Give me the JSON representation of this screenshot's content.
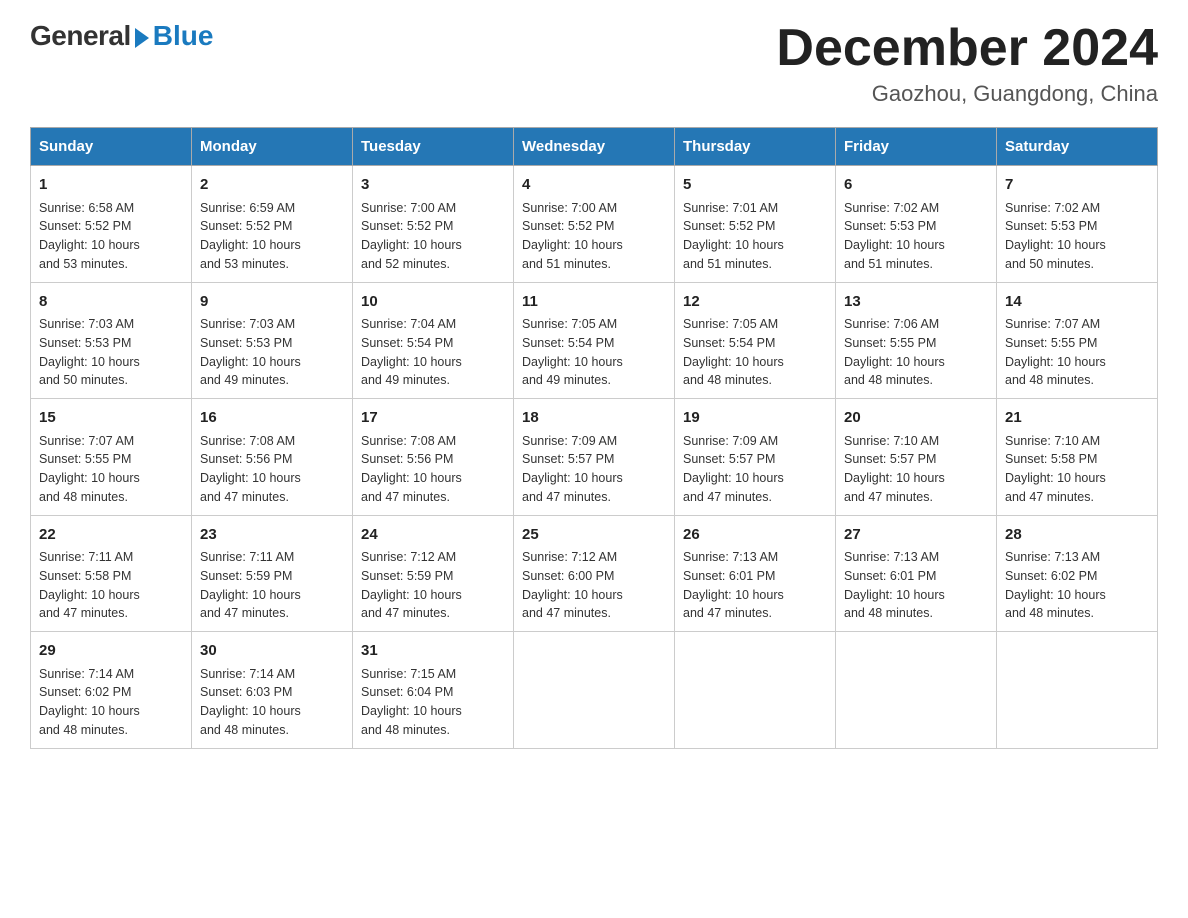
{
  "logo": {
    "general": "General",
    "blue": "Blue"
  },
  "title": {
    "month": "December 2024",
    "location": "Gaozhou, Guangdong, China"
  },
  "days_of_week": [
    "Sunday",
    "Monday",
    "Tuesday",
    "Wednesday",
    "Thursday",
    "Friday",
    "Saturday"
  ],
  "weeks": [
    [
      {
        "day": "1",
        "sunrise": "6:58 AM",
        "sunset": "5:52 PM",
        "daylight": "10 hours and 53 minutes."
      },
      {
        "day": "2",
        "sunrise": "6:59 AM",
        "sunset": "5:52 PM",
        "daylight": "10 hours and 53 minutes."
      },
      {
        "day": "3",
        "sunrise": "7:00 AM",
        "sunset": "5:52 PM",
        "daylight": "10 hours and 52 minutes."
      },
      {
        "day": "4",
        "sunrise": "7:00 AM",
        "sunset": "5:52 PM",
        "daylight": "10 hours and 51 minutes."
      },
      {
        "day": "5",
        "sunrise": "7:01 AM",
        "sunset": "5:52 PM",
        "daylight": "10 hours and 51 minutes."
      },
      {
        "day": "6",
        "sunrise": "7:02 AM",
        "sunset": "5:53 PM",
        "daylight": "10 hours and 51 minutes."
      },
      {
        "day": "7",
        "sunrise": "7:02 AM",
        "sunset": "5:53 PM",
        "daylight": "10 hours and 50 minutes."
      }
    ],
    [
      {
        "day": "8",
        "sunrise": "7:03 AM",
        "sunset": "5:53 PM",
        "daylight": "10 hours and 50 minutes."
      },
      {
        "day": "9",
        "sunrise": "7:03 AM",
        "sunset": "5:53 PM",
        "daylight": "10 hours and 49 minutes."
      },
      {
        "day": "10",
        "sunrise": "7:04 AM",
        "sunset": "5:54 PM",
        "daylight": "10 hours and 49 minutes."
      },
      {
        "day": "11",
        "sunrise": "7:05 AM",
        "sunset": "5:54 PM",
        "daylight": "10 hours and 49 minutes."
      },
      {
        "day": "12",
        "sunrise": "7:05 AM",
        "sunset": "5:54 PM",
        "daylight": "10 hours and 48 minutes."
      },
      {
        "day": "13",
        "sunrise": "7:06 AM",
        "sunset": "5:55 PM",
        "daylight": "10 hours and 48 minutes."
      },
      {
        "day": "14",
        "sunrise": "7:07 AM",
        "sunset": "5:55 PM",
        "daylight": "10 hours and 48 minutes."
      }
    ],
    [
      {
        "day": "15",
        "sunrise": "7:07 AM",
        "sunset": "5:55 PM",
        "daylight": "10 hours and 48 minutes."
      },
      {
        "day": "16",
        "sunrise": "7:08 AM",
        "sunset": "5:56 PM",
        "daylight": "10 hours and 47 minutes."
      },
      {
        "day": "17",
        "sunrise": "7:08 AM",
        "sunset": "5:56 PM",
        "daylight": "10 hours and 47 minutes."
      },
      {
        "day": "18",
        "sunrise": "7:09 AM",
        "sunset": "5:57 PM",
        "daylight": "10 hours and 47 minutes."
      },
      {
        "day": "19",
        "sunrise": "7:09 AM",
        "sunset": "5:57 PM",
        "daylight": "10 hours and 47 minutes."
      },
      {
        "day": "20",
        "sunrise": "7:10 AM",
        "sunset": "5:57 PM",
        "daylight": "10 hours and 47 minutes."
      },
      {
        "day": "21",
        "sunrise": "7:10 AM",
        "sunset": "5:58 PM",
        "daylight": "10 hours and 47 minutes."
      }
    ],
    [
      {
        "day": "22",
        "sunrise": "7:11 AM",
        "sunset": "5:58 PM",
        "daylight": "10 hours and 47 minutes."
      },
      {
        "day": "23",
        "sunrise": "7:11 AM",
        "sunset": "5:59 PM",
        "daylight": "10 hours and 47 minutes."
      },
      {
        "day": "24",
        "sunrise": "7:12 AM",
        "sunset": "5:59 PM",
        "daylight": "10 hours and 47 minutes."
      },
      {
        "day": "25",
        "sunrise": "7:12 AM",
        "sunset": "6:00 PM",
        "daylight": "10 hours and 47 minutes."
      },
      {
        "day": "26",
        "sunrise": "7:13 AM",
        "sunset": "6:01 PM",
        "daylight": "10 hours and 47 minutes."
      },
      {
        "day": "27",
        "sunrise": "7:13 AM",
        "sunset": "6:01 PM",
        "daylight": "10 hours and 48 minutes."
      },
      {
        "day": "28",
        "sunrise": "7:13 AM",
        "sunset": "6:02 PM",
        "daylight": "10 hours and 48 minutes."
      }
    ],
    [
      {
        "day": "29",
        "sunrise": "7:14 AM",
        "sunset": "6:02 PM",
        "daylight": "10 hours and 48 minutes."
      },
      {
        "day": "30",
        "sunrise": "7:14 AM",
        "sunset": "6:03 PM",
        "daylight": "10 hours and 48 minutes."
      },
      {
        "day": "31",
        "sunrise": "7:15 AM",
        "sunset": "6:04 PM",
        "daylight": "10 hours and 48 minutes."
      },
      null,
      null,
      null,
      null
    ]
  ],
  "labels": {
    "sunrise": "Sunrise:",
    "sunset": "Sunset:",
    "daylight": "Daylight:"
  }
}
